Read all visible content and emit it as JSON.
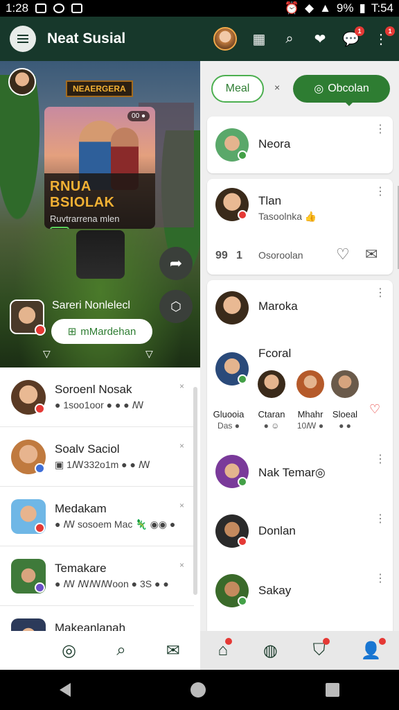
{
  "status": {
    "time_left": "1:28",
    "battery": "9%",
    "time_right": "T:54"
  },
  "app": {
    "title": "Neat Susial"
  },
  "appbar": {
    "icons": [
      "menu-icon",
      "grid-icon",
      "search-icon",
      "heart-icon",
      "chat-icon",
      "more-icon"
    ],
    "chat_badge": "1",
    "more_badge": "1"
  },
  "hero": {
    "sign": "NEAERGERA",
    "card_chip": "00 ●",
    "game_title": "RNUA BSIOLAK",
    "game_subtitle": "Ruvtrarrena mlen",
    "game_score": "00",
    "user_name": "Sareri Nonlelecl",
    "join_label": "mMardehan"
  },
  "left_list": [
    {
      "name": "Soroenl Nosak",
      "sub": "● 1soo1oor ● ● ● ꟿ",
      "close": "×"
    },
    {
      "name": "Soalv Saciol",
      "sub": "▣ 1ꟿ332o1m ● ● ꟿ",
      "close": "×"
    },
    {
      "name": "Medakam",
      "sub": "● ꟿ sosoem Mac 🦎 ◉◉ ●",
      "close": "×"
    },
    {
      "name": "Temakare",
      "sub": "● ꟿ ꟿꟿꟿoon ● 3S ● ●",
      "close": "×"
    },
    {
      "name": "Makeanlanah",
      "sub": "",
      "close": ""
    }
  ],
  "filters": {
    "meal": "Meal",
    "separator": "×",
    "active": "Obcolan"
  },
  "feed": {
    "c1": {
      "name": "Neora"
    },
    "c2": {
      "name": "Tlan",
      "sub": "Tasoolnka 👍",
      "stat1": "99",
      "stat2": "1",
      "stat3": "Osoroolan"
    },
    "c3": {
      "name": "Maroka"
    },
    "group": {
      "name": "Fcoral",
      "members": [
        {
          "name": "Gluooia",
          "sub": "Das ●"
        },
        {
          "name": "Ctaran",
          "sub": "● ☺"
        },
        {
          "name": "Mhahr",
          "sub": "10ꟿ ●"
        },
        {
          "name": "Sloeal",
          "sub": "● ●"
        }
      ]
    },
    "c4": {
      "name": "Nak Temar◎"
    },
    "c5": {
      "name": "Donlan"
    },
    "c6": {
      "name": "Sakay"
    }
  },
  "nav": {
    "left": [
      "chat-bubble-icon",
      "search-icon",
      "mail-icon"
    ],
    "right": [
      "home-icon",
      "sport-ball-icon",
      "shield-icon",
      "profile-icon"
    ]
  },
  "colors": {
    "brand": "#17382b",
    "accent": "#2e7d32",
    "badge": "#e53935"
  }
}
